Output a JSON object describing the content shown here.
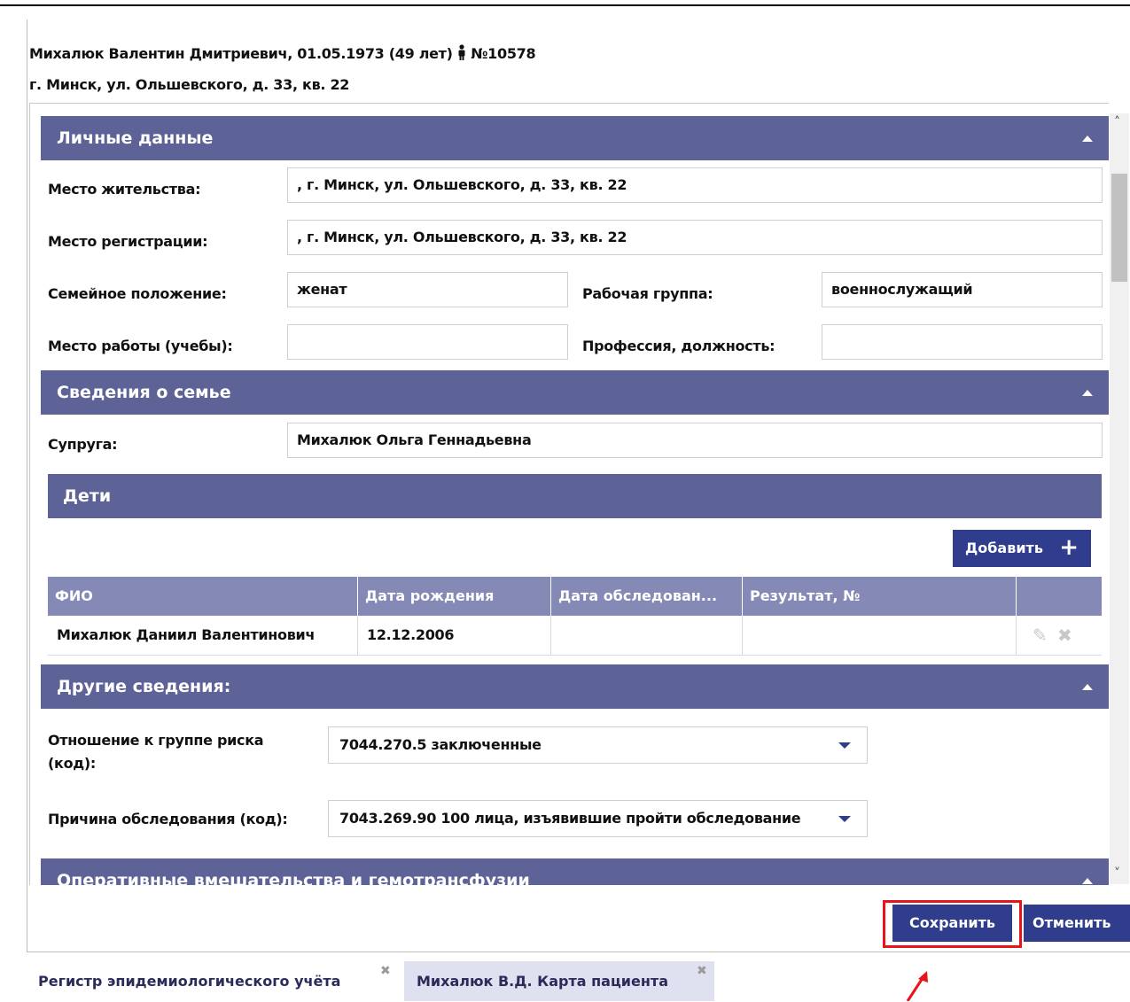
{
  "patient": {
    "header_line": "Михалюк Валентин Дмитриевич, 01.05.1973 (49 лет)",
    "number": "№10578",
    "address": "г. Минск, ул. Ольшевского, д. 33, кв. 22"
  },
  "personal": {
    "title": "Личные данные",
    "residence_label": "Место жительства:",
    "residence_value": ", г. Минск, ул. Ольшевского, д. 33, кв. 22",
    "registration_label": "Место регистрации:",
    "registration_value": ", г. Минск, ул. Ольшевского, д. 33, кв. 22",
    "marital_label": "Семейное положение:",
    "marital_value": "женат",
    "work_group_label": "Рабочая группа:",
    "work_group_value": "военнослужащий",
    "workplace_label": "Место работы (учебы):",
    "workplace_value": "",
    "profession_label": "Профессия, должность:",
    "profession_value": ""
  },
  "family": {
    "title": "Сведения о семье",
    "spouse_label": "Супруга:",
    "spouse_value": "Михалюк Ольга Геннадьевна",
    "children_title": "Дети",
    "add_label": "Добавить",
    "columns": [
      "ФИО",
      "Дата рождения",
      "Дата обследован...",
      "Результат, №"
    ],
    "rows": [
      {
        "name": "Михалюк Даниил Валентинович",
        "birth": "12.12.2006",
        "exam_date": "",
        "result": ""
      }
    ]
  },
  "other": {
    "title": "Другие сведения:",
    "risk_label_line1": "Отношение к группе риска",
    "risk_label_line2": "(код):",
    "risk_value": "7044.270.5 заключенные",
    "reason_label": "Причина обследования (код):",
    "reason_value": "7043.269.90 100 лица, изъявившие пройти обследование"
  },
  "next_section": {
    "title": "Оперативные вмешательства и гемотрансфузии"
  },
  "actions": {
    "save": "Сохранить",
    "cancel": "Отменить"
  },
  "tabs": [
    {
      "label": "Регистр эпидемиологического учёта"
    },
    {
      "label": "Михалюк В.Д. Карта пациента"
    }
  ],
  "colors": {
    "section_header": "#5e6397",
    "table_header": "#8589b6",
    "button": "#2f3d8c",
    "highlight": "#e8141a"
  }
}
